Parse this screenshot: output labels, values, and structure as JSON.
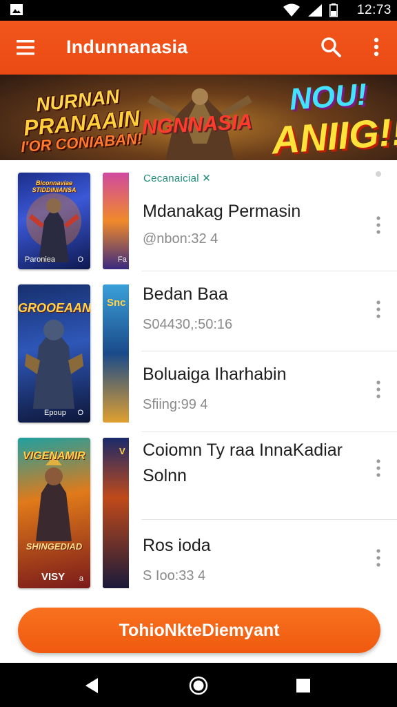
{
  "status_bar": {
    "time": "12:73",
    "icons": [
      "image-icon",
      "wifi-icon",
      "signal-icon",
      "battery-icon"
    ]
  },
  "app_bar": {
    "title": "Indunnanasia",
    "menu_icon": "hamburger-menu-icon",
    "search_icon": "search-icon",
    "more_icon": "more-vert-icon"
  },
  "banner": {
    "left_line1": "NURNAN",
    "left_line2": "PRANAAIN",
    "left_line3": "I'OR CONIABAN!",
    "center_text": "NGNNASIA",
    "right_line1": "NOU!",
    "right_line2": "ANIIG!!"
  },
  "list": {
    "tag": "Cecanaicial ✕",
    "items": [
      {
        "title": "Mdanakag Permasin",
        "meta": "@nbon:32 4",
        "thumb_title": "Biconnaviae\nSTIDDINIANSA",
        "thumb_foot": "Paroniea",
        "thumb_foot_b": "O"
      },
      {
        "title": "Bedan Baa",
        "meta": "S04430,:50:16",
        "thumb_title": "GROOEAAN",
        "thumb_foot": "Epoup",
        "thumb_foot_b": "O"
      },
      {
        "title": "Boluaiga Iharhabin",
        "meta": "Sfiing:99 4",
        "thumb_title": "",
        "thumb_foot": "",
        "thumb_foot_b": ""
      },
      {
        "title": "Coiomn Ty raa InnaKadiar Solnn",
        "meta": "",
        "thumb_title": "VIGENAMIR",
        "thumb_foot": "VISY",
        "thumb_foot_b": "a",
        "thumb_sub": "SHINGEDIAD"
      },
      {
        "title": "Ros ioda",
        "meta": "S Ioo:33 4",
        "thumb_title": "",
        "thumb_foot": "",
        "thumb_foot_b": ""
      }
    ]
  },
  "cta": {
    "label": "TohioNkteDiemyant"
  },
  "nav_bar": {
    "icons": [
      "back-triangle-icon",
      "home-circle-icon",
      "recents-square-icon"
    ]
  },
  "colors": {
    "accent": "#f2561c",
    "tag": "#1f8b7a"
  }
}
